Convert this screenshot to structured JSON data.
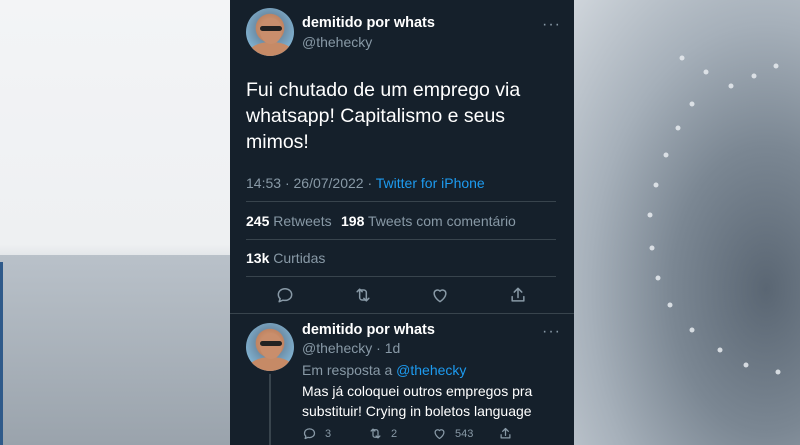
{
  "main_tweet": {
    "display_name": "demitido por whats",
    "handle": "@thehecky",
    "text_lines": [
      "Fui chutado de um emprego via",
      "whatsapp! Capitalismo e seus",
      "mimos!"
    ],
    "time": "14:53",
    "separator": "·",
    "date": "26/07/2022",
    "source": "Twitter for iPhone",
    "retweets_count": "245",
    "retweets_label": "Retweets",
    "quotes_count": "198",
    "quotes_label": "Tweets com comentário",
    "likes_count": "13k",
    "likes_label": "Curtidas",
    "more_symbol": "···"
  },
  "reply_tweet": {
    "display_name": "demitido por whats",
    "handle": "@thehecky",
    "time_ago": "1d",
    "reply_prefix": "Em resposta a",
    "reply_target": "@thehecky",
    "text_lines": [
      "Mas já coloquei outros empregos pra",
      "substituir! Crying in boletos language"
    ],
    "reply_count": "3",
    "retweet_count": "2",
    "like_count": "543",
    "more_symbol": "···"
  },
  "icons": {
    "reply": "reply-icon",
    "retweet": "retweet-icon",
    "like": "heart-icon",
    "share": "share-icon",
    "more": "more-icon"
  },
  "colors": {
    "background": "#15202b",
    "text": "#ffffff",
    "secondary_text": "#8899a6",
    "link": "#1d9bf0",
    "divider": "#38444d"
  }
}
